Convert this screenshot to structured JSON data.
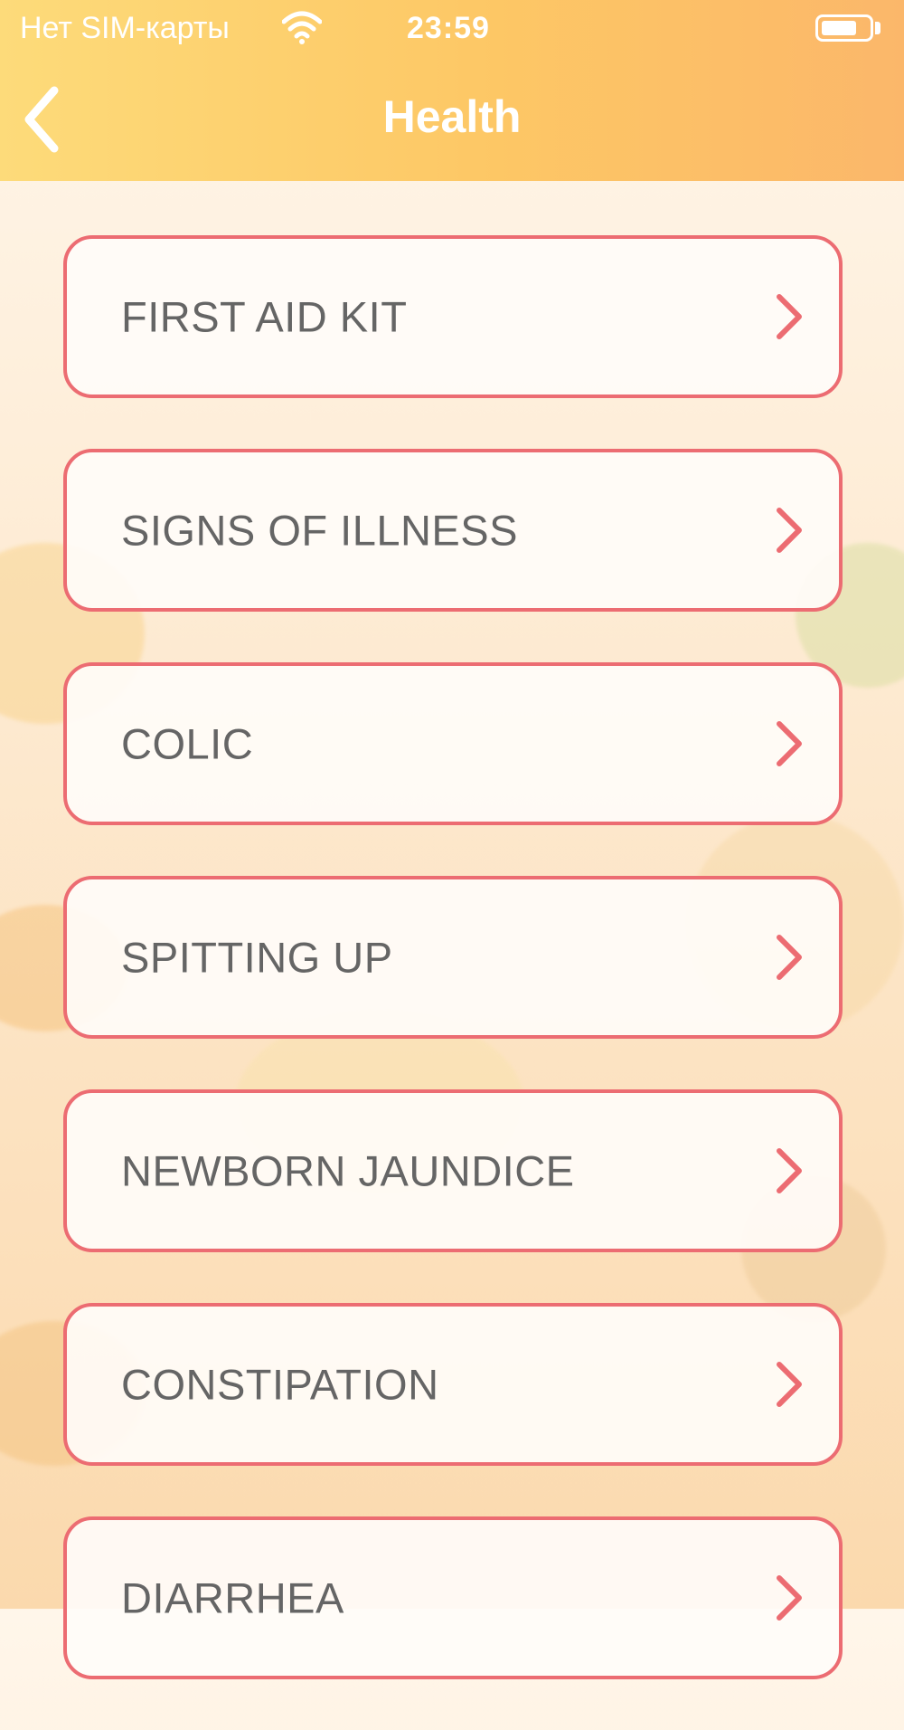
{
  "status_bar": {
    "carrier": "Нет SIM-карты",
    "time": "23:59"
  },
  "header": {
    "title": "Health",
    "back_icon": "chevron-left-icon"
  },
  "menu": {
    "items": [
      {
        "label": "FIRST AID KIT"
      },
      {
        "label": "SIGNS OF ILLNESS"
      },
      {
        "label": "COLIC"
      },
      {
        "label": "SPITTING UP"
      },
      {
        "label": "NEWBORN JAUNDICE"
      },
      {
        "label": "CONSTIPATION"
      },
      {
        "label": "DIARRHEA"
      }
    ],
    "chevron_icon": "chevron-right-icon"
  },
  "colors": {
    "header_gradient_start": "#fddb7a",
    "header_gradient_end": "#fbb76a",
    "item_border": "#ec6c72",
    "item_text": "#656565",
    "title_text": "#ffffff"
  }
}
